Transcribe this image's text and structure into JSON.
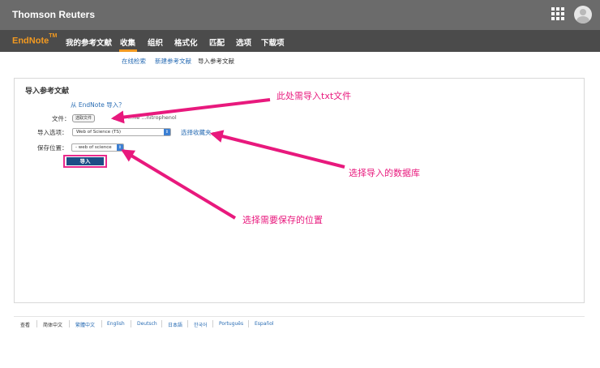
{
  "header": {
    "brand": "Thomson Reuters",
    "apps_icon": "grid-icon",
    "avatar_icon": "user-avatar-icon"
  },
  "nav": {
    "logo": "EndNote",
    "logo_mark": "TM",
    "items": [
      "我的参考文献",
      "收集",
      "组织",
      "格式化",
      "匹配",
      "选项",
      "下载项"
    ],
    "active": "收集"
  },
  "subnav": {
    "items": [
      "在线检索",
      "新建参考文献",
      "导入参考文献"
    ],
    "current": "导入参考文献"
  },
  "import_form": {
    "title": "导入参考文献",
    "from_endnote": "从 EndNote 导入？",
    "file_label": "文件：",
    "choose_file_button": "选取文件",
    "file_name": "...ne ...nitrophenol",
    "import_option_label": "导入选项：",
    "import_option_value": "Web of Science (TS)",
    "choose_folder_link": "选择收藏夹",
    "save_location_label": "保存位置：",
    "save_location_value": "- web of science",
    "import_button": "导入"
  },
  "annotations": {
    "import_txt": "此处需导入txt文件",
    "choose_database": "选择导入的数据库",
    "choose_location": "选择需要保存的位置",
    "color": "#e8197d"
  },
  "footer": {
    "view_label": "查看",
    "languages": [
      "简体中文",
      "繁體中文",
      "English",
      "Deutsch",
      "日本語",
      "한국어",
      "Português",
      "Español"
    ]
  },
  "colors": {
    "accent": "#f39a21",
    "link": "#2a6db4",
    "import_button": "#1d4e86",
    "topbar": "#6b6b6b",
    "navbar": "#4b4b4b"
  }
}
